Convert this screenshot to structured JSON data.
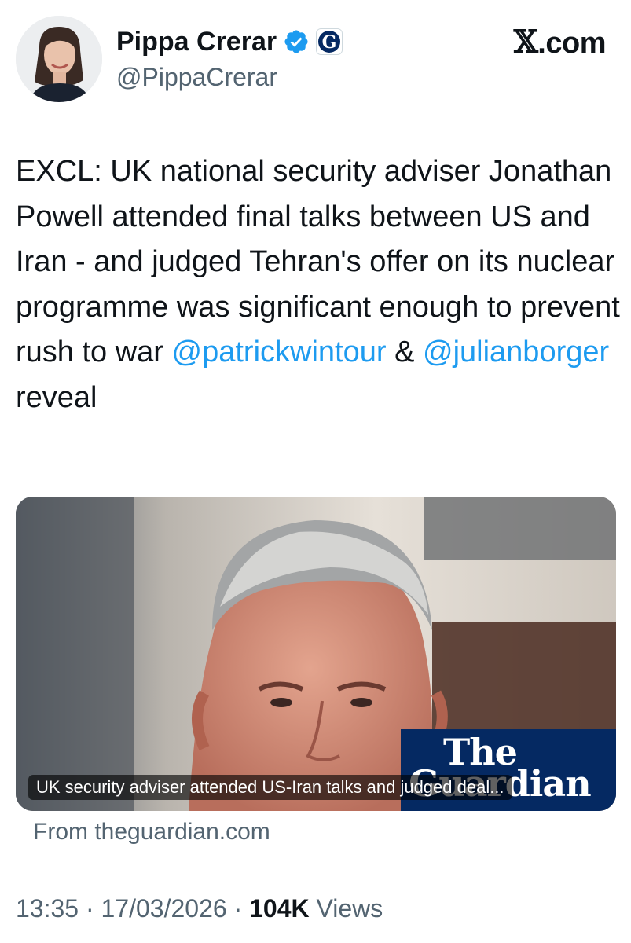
{
  "author": {
    "display_name": "Pippa Crerar",
    "handle": "@PippaCrerar",
    "verified_icon": "verified-badge-icon",
    "affiliation_icon": "guardian-logo-icon"
  },
  "site_label": {
    "x": "𝕏",
    "suffix": ".com"
  },
  "tweet": {
    "text_before": "EXCL: UK national security adviser Jonathan Powell attended final talks between US and Iran - and judged Tehran's offer on its nuclear programme was significant enough to prevent rush to war ",
    "mention_1": "@patrickwintour",
    "connector": " & ",
    "mention_2": "@julianborger",
    "text_after": " reveal"
  },
  "card": {
    "brand_line_1": "The",
    "brand_line_2": "Guardian",
    "caption": "UK security adviser attended US-Iran talks and judged deal...",
    "source": "From theguardian.com"
  },
  "meta": {
    "time": "13:35",
    "separator_1": " · ",
    "date": "17/03/2026",
    "separator_2": " · ",
    "views_count": "104K",
    "views_label": " Views"
  },
  "colors": {
    "link": "#1d9bf0",
    "secondary_text": "#536471",
    "guardian_blue": "#052962"
  }
}
